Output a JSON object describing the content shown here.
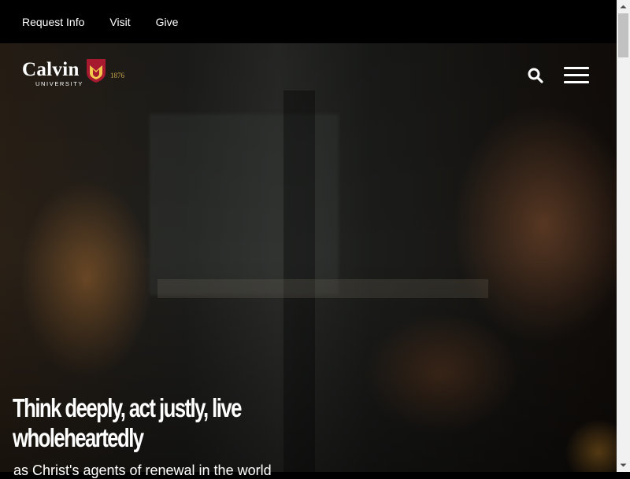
{
  "utility_nav": {
    "items": [
      {
        "label": "Request Info"
      },
      {
        "label": "Visit"
      },
      {
        "label": "Give"
      }
    ]
  },
  "logo": {
    "wordmark": "Calvin",
    "subtitle": "UNIVERSITY",
    "year": "1876"
  },
  "header": {
    "search_icon": "search-icon",
    "menu_icon": "hamburger-menu-icon"
  },
  "hero": {
    "headline": "Think deeply, act justly, live wholeheartedly",
    "subheadline": "as Christ's agents of renewal in the world"
  },
  "colors": {
    "brand_red": "#a6192e",
    "brand_gold": "#f2c94c",
    "year_gold": "#c9a44a",
    "utility_bar": "#000000"
  }
}
